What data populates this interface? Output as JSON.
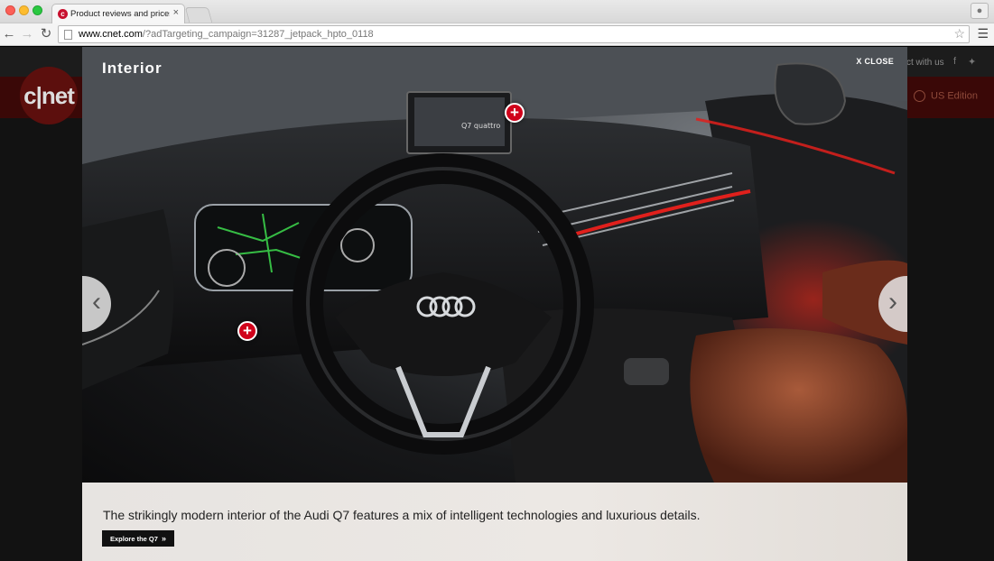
{
  "browser": {
    "tab_title": "Product reviews and prices",
    "tab_favicon": "c",
    "tab_close": "×",
    "url_host": "www.cnet.com",
    "url_path": "/?adTargeting_campaign=31287_jetpack_hpto_0118",
    "icons": {
      "back": "back-arrow-icon",
      "forward": "forward-arrow-icon",
      "reload": "reload-icon",
      "bookmark": "star-icon",
      "menu": "hamburger-menu-icon",
      "profile": "person-icon"
    }
  },
  "site": {
    "logo": "c|net",
    "connect_text": "ct with us",
    "edition": "US Edition"
  },
  "modal": {
    "title": "Interior",
    "close_label": "X CLOSE",
    "caption": "The strikingly modern interior of the Audi Q7 features a mix of intelligent technologies and luxurious details.",
    "cta_label": "Explore the Q7",
    "cta_chevron": "»",
    "prev_arrow": "‹",
    "next_arrow": "›",
    "hotspot_symbol": "+",
    "screen_text": "Q7 quattro"
  },
  "colors": {
    "hotspot": "#d0021b",
    "ambient_light": "#e0201c",
    "caption_bg": "#e7e4e1"
  }
}
